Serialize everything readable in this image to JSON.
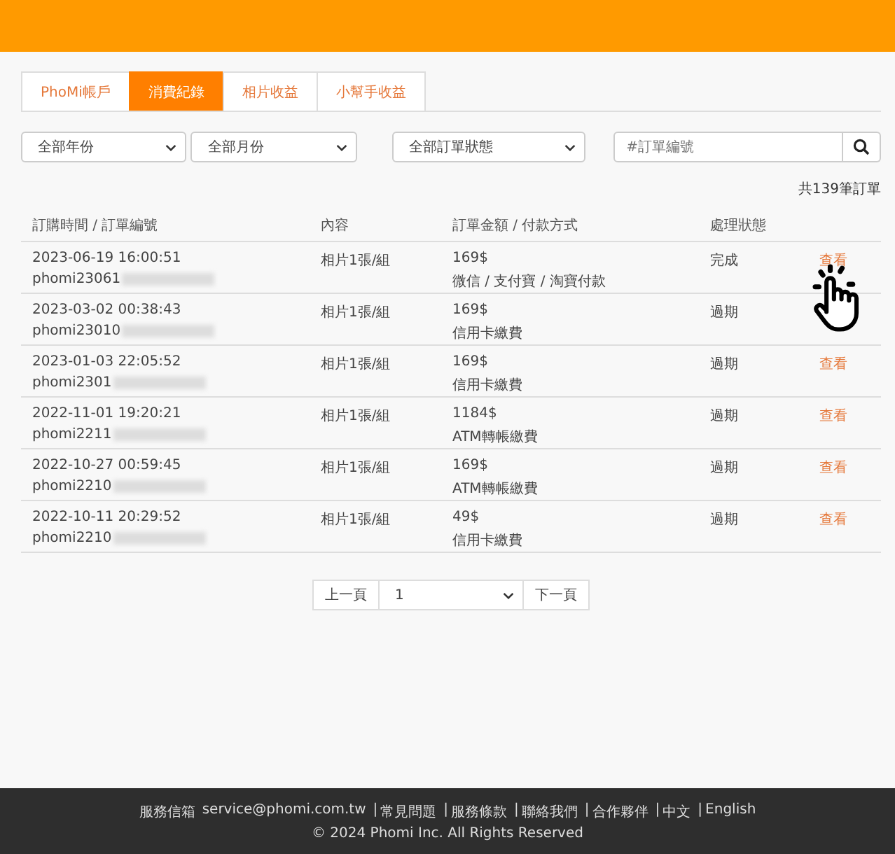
{
  "tabs": [
    {
      "label": "PhoMi帳戶",
      "selected": false
    },
    {
      "label": "消費紀錄",
      "selected": true
    },
    {
      "label": "相片收益",
      "selected": false
    },
    {
      "label": "小幫手收益",
      "selected": false
    }
  ],
  "filters": {
    "year": "全部年份",
    "month": "全部月份",
    "status": "全部訂單狀態",
    "search_placeholder": "#訂單編號"
  },
  "count": "共139筆訂單",
  "table": {
    "columns": [
      "訂購時間 / 訂單編號",
      "內容",
      "訂單金額 / 付款方式",
      "處理狀態"
    ],
    "rows": [
      {
        "time": "2023-06-19 16:00:51",
        "order_no": "phomi23061",
        "content": "相片1張/組",
        "amount": "169$",
        "payment": "微信 / 支付寶 / 淘寶付款",
        "status": "完成",
        "action": "查看"
      },
      {
        "time": "2023-03-02 00:38:43",
        "order_no": "phomi23010",
        "content": "相片1張/組",
        "amount": "169$",
        "payment": "信用卡繳費",
        "status": "過期"
      },
      {
        "time": "2023-01-03 22:05:52",
        "order_no": "phomi2301",
        "content": "相片1張/組",
        "amount": "169$",
        "payment": "信用卡繳費",
        "status": "過期",
        "action": "查看"
      },
      {
        "time": "2022-11-01 19:20:21",
        "order_no": "phomi2211",
        "content": "相片1張/組",
        "amount": "1184$",
        "payment": "ATM轉帳繳費",
        "status": "過期",
        "action": "查看"
      },
      {
        "time": "2022-10-27 00:59:45",
        "order_no": "phomi2210",
        "content": "相片1張/組",
        "amount": "169$",
        "payment": "ATM轉帳繳費",
        "status": "過期",
        "action": "查看"
      },
      {
        "time": "2022-10-11 20:29:52",
        "order_no": "phomi2210",
        "content": "相片1張/組",
        "amount": "49$",
        "payment": "信用卡繳費",
        "status": "過期",
        "action": "查看"
      }
    ]
  },
  "pagination": {
    "prev": "上一頁",
    "page": "1",
    "next": "下一頁"
  },
  "footer": {
    "mail_label": "服務信箱",
    "email": "service@phomi.com.tw",
    "separator": "|",
    "links": [
      "常見問題",
      "服務條款",
      "聯絡我們",
      "合作夥伴",
      "中文",
      "English"
    ],
    "copyright": "© 2024 Phomi Inc. All Rights Reserved"
  }
}
